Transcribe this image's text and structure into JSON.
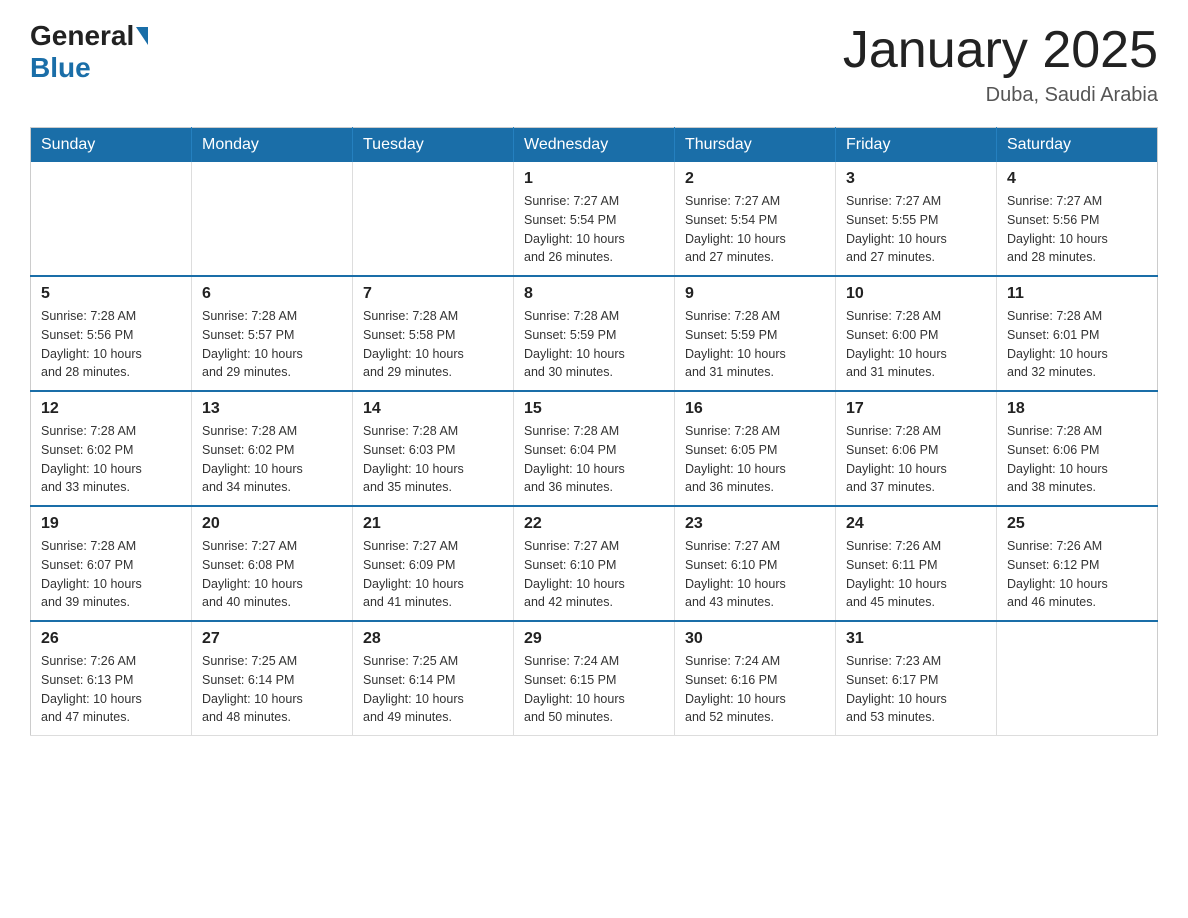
{
  "header": {
    "logo": {
      "general": "General",
      "blue": "Blue"
    },
    "title": "January 2025",
    "location": "Duba, Saudi Arabia"
  },
  "weekdays": [
    "Sunday",
    "Monday",
    "Tuesday",
    "Wednesday",
    "Thursday",
    "Friday",
    "Saturday"
  ],
  "weeks": [
    [
      {
        "day": "",
        "info": ""
      },
      {
        "day": "",
        "info": ""
      },
      {
        "day": "",
        "info": ""
      },
      {
        "day": "1",
        "info": "Sunrise: 7:27 AM\nSunset: 5:54 PM\nDaylight: 10 hours\nand 26 minutes."
      },
      {
        "day": "2",
        "info": "Sunrise: 7:27 AM\nSunset: 5:54 PM\nDaylight: 10 hours\nand 27 minutes."
      },
      {
        "day": "3",
        "info": "Sunrise: 7:27 AM\nSunset: 5:55 PM\nDaylight: 10 hours\nand 27 minutes."
      },
      {
        "day": "4",
        "info": "Sunrise: 7:27 AM\nSunset: 5:56 PM\nDaylight: 10 hours\nand 28 minutes."
      }
    ],
    [
      {
        "day": "5",
        "info": "Sunrise: 7:28 AM\nSunset: 5:56 PM\nDaylight: 10 hours\nand 28 minutes."
      },
      {
        "day": "6",
        "info": "Sunrise: 7:28 AM\nSunset: 5:57 PM\nDaylight: 10 hours\nand 29 minutes."
      },
      {
        "day": "7",
        "info": "Sunrise: 7:28 AM\nSunset: 5:58 PM\nDaylight: 10 hours\nand 29 minutes."
      },
      {
        "day": "8",
        "info": "Sunrise: 7:28 AM\nSunset: 5:59 PM\nDaylight: 10 hours\nand 30 minutes."
      },
      {
        "day": "9",
        "info": "Sunrise: 7:28 AM\nSunset: 5:59 PM\nDaylight: 10 hours\nand 31 minutes."
      },
      {
        "day": "10",
        "info": "Sunrise: 7:28 AM\nSunset: 6:00 PM\nDaylight: 10 hours\nand 31 minutes."
      },
      {
        "day": "11",
        "info": "Sunrise: 7:28 AM\nSunset: 6:01 PM\nDaylight: 10 hours\nand 32 minutes."
      }
    ],
    [
      {
        "day": "12",
        "info": "Sunrise: 7:28 AM\nSunset: 6:02 PM\nDaylight: 10 hours\nand 33 minutes."
      },
      {
        "day": "13",
        "info": "Sunrise: 7:28 AM\nSunset: 6:02 PM\nDaylight: 10 hours\nand 34 minutes."
      },
      {
        "day": "14",
        "info": "Sunrise: 7:28 AM\nSunset: 6:03 PM\nDaylight: 10 hours\nand 35 minutes."
      },
      {
        "day": "15",
        "info": "Sunrise: 7:28 AM\nSunset: 6:04 PM\nDaylight: 10 hours\nand 36 minutes."
      },
      {
        "day": "16",
        "info": "Sunrise: 7:28 AM\nSunset: 6:05 PM\nDaylight: 10 hours\nand 36 minutes."
      },
      {
        "day": "17",
        "info": "Sunrise: 7:28 AM\nSunset: 6:06 PM\nDaylight: 10 hours\nand 37 minutes."
      },
      {
        "day": "18",
        "info": "Sunrise: 7:28 AM\nSunset: 6:06 PM\nDaylight: 10 hours\nand 38 minutes."
      }
    ],
    [
      {
        "day": "19",
        "info": "Sunrise: 7:28 AM\nSunset: 6:07 PM\nDaylight: 10 hours\nand 39 minutes."
      },
      {
        "day": "20",
        "info": "Sunrise: 7:27 AM\nSunset: 6:08 PM\nDaylight: 10 hours\nand 40 minutes."
      },
      {
        "day": "21",
        "info": "Sunrise: 7:27 AM\nSunset: 6:09 PM\nDaylight: 10 hours\nand 41 minutes."
      },
      {
        "day": "22",
        "info": "Sunrise: 7:27 AM\nSunset: 6:10 PM\nDaylight: 10 hours\nand 42 minutes."
      },
      {
        "day": "23",
        "info": "Sunrise: 7:27 AM\nSunset: 6:10 PM\nDaylight: 10 hours\nand 43 minutes."
      },
      {
        "day": "24",
        "info": "Sunrise: 7:26 AM\nSunset: 6:11 PM\nDaylight: 10 hours\nand 45 minutes."
      },
      {
        "day": "25",
        "info": "Sunrise: 7:26 AM\nSunset: 6:12 PM\nDaylight: 10 hours\nand 46 minutes."
      }
    ],
    [
      {
        "day": "26",
        "info": "Sunrise: 7:26 AM\nSunset: 6:13 PM\nDaylight: 10 hours\nand 47 minutes."
      },
      {
        "day": "27",
        "info": "Sunrise: 7:25 AM\nSunset: 6:14 PM\nDaylight: 10 hours\nand 48 minutes."
      },
      {
        "day": "28",
        "info": "Sunrise: 7:25 AM\nSunset: 6:14 PM\nDaylight: 10 hours\nand 49 minutes."
      },
      {
        "day": "29",
        "info": "Sunrise: 7:24 AM\nSunset: 6:15 PM\nDaylight: 10 hours\nand 50 minutes."
      },
      {
        "day": "30",
        "info": "Sunrise: 7:24 AM\nSunset: 6:16 PM\nDaylight: 10 hours\nand 52 minutes."
      },
      {
        "day": "31",
        "info": "Sunrise: 7:23 AM\nSunset: 6:17 PM\nDaylight: 10 hours\nand 53 minutes."
      },
      {
        "day": "",
        "info": ""
      }
    ]
  ]
}
